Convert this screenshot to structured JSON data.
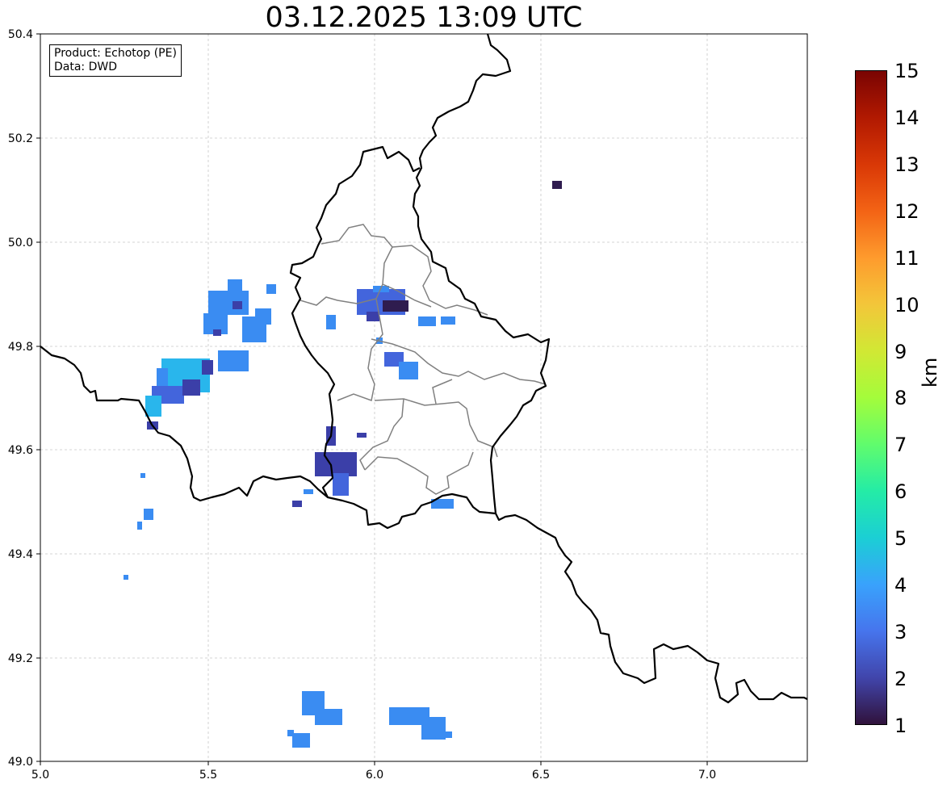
{
  "title": "03.12.2025 13:09 UTC",
  "info": {
    "product": "Product: Echotop (PE)",
    "data": "Data: DWD"
  },
  "map": {
    "x_ticks": [
      "5.0",
      "5.5",
      "6.0",
      "6.5",
      "7.0"
    ],
    "y_ticks": [
      "49.0",
      "49.2",
      "49.4",
      "49.6",
      "49.8",
      "50.0",
      "50.2",
      "50.4"
    ],
    "lon_range": [
      5.0,
      7.3
    ],
    "lat_range": [
      49.0,
      50.4
    ],
    "grid": true
  },
  "colorbar": {
    "label": "km",
    "ticks": [
      "15",
      "14",
      "13",
      "12",
      "11",
      "10",
      "9",
      "8",
      "7",
      "6",
      "5",
      "4",
      "3",
      "2",
      "1"
    ],
    "range": [
      1,
      15
    ],
    "colormap": "turbo"
  },
  "colors": {
    "echo_light": "#3a8cf2",
    "echo_cyan": "#29b6ec",
    "echo_mid": "#4365dc",
    "echo_dark": "#3b3fa8",
    "echo_darkest": "#2f1c4f",
    "border": "#000000",
    "admin_border": "#808080"
  }
}
